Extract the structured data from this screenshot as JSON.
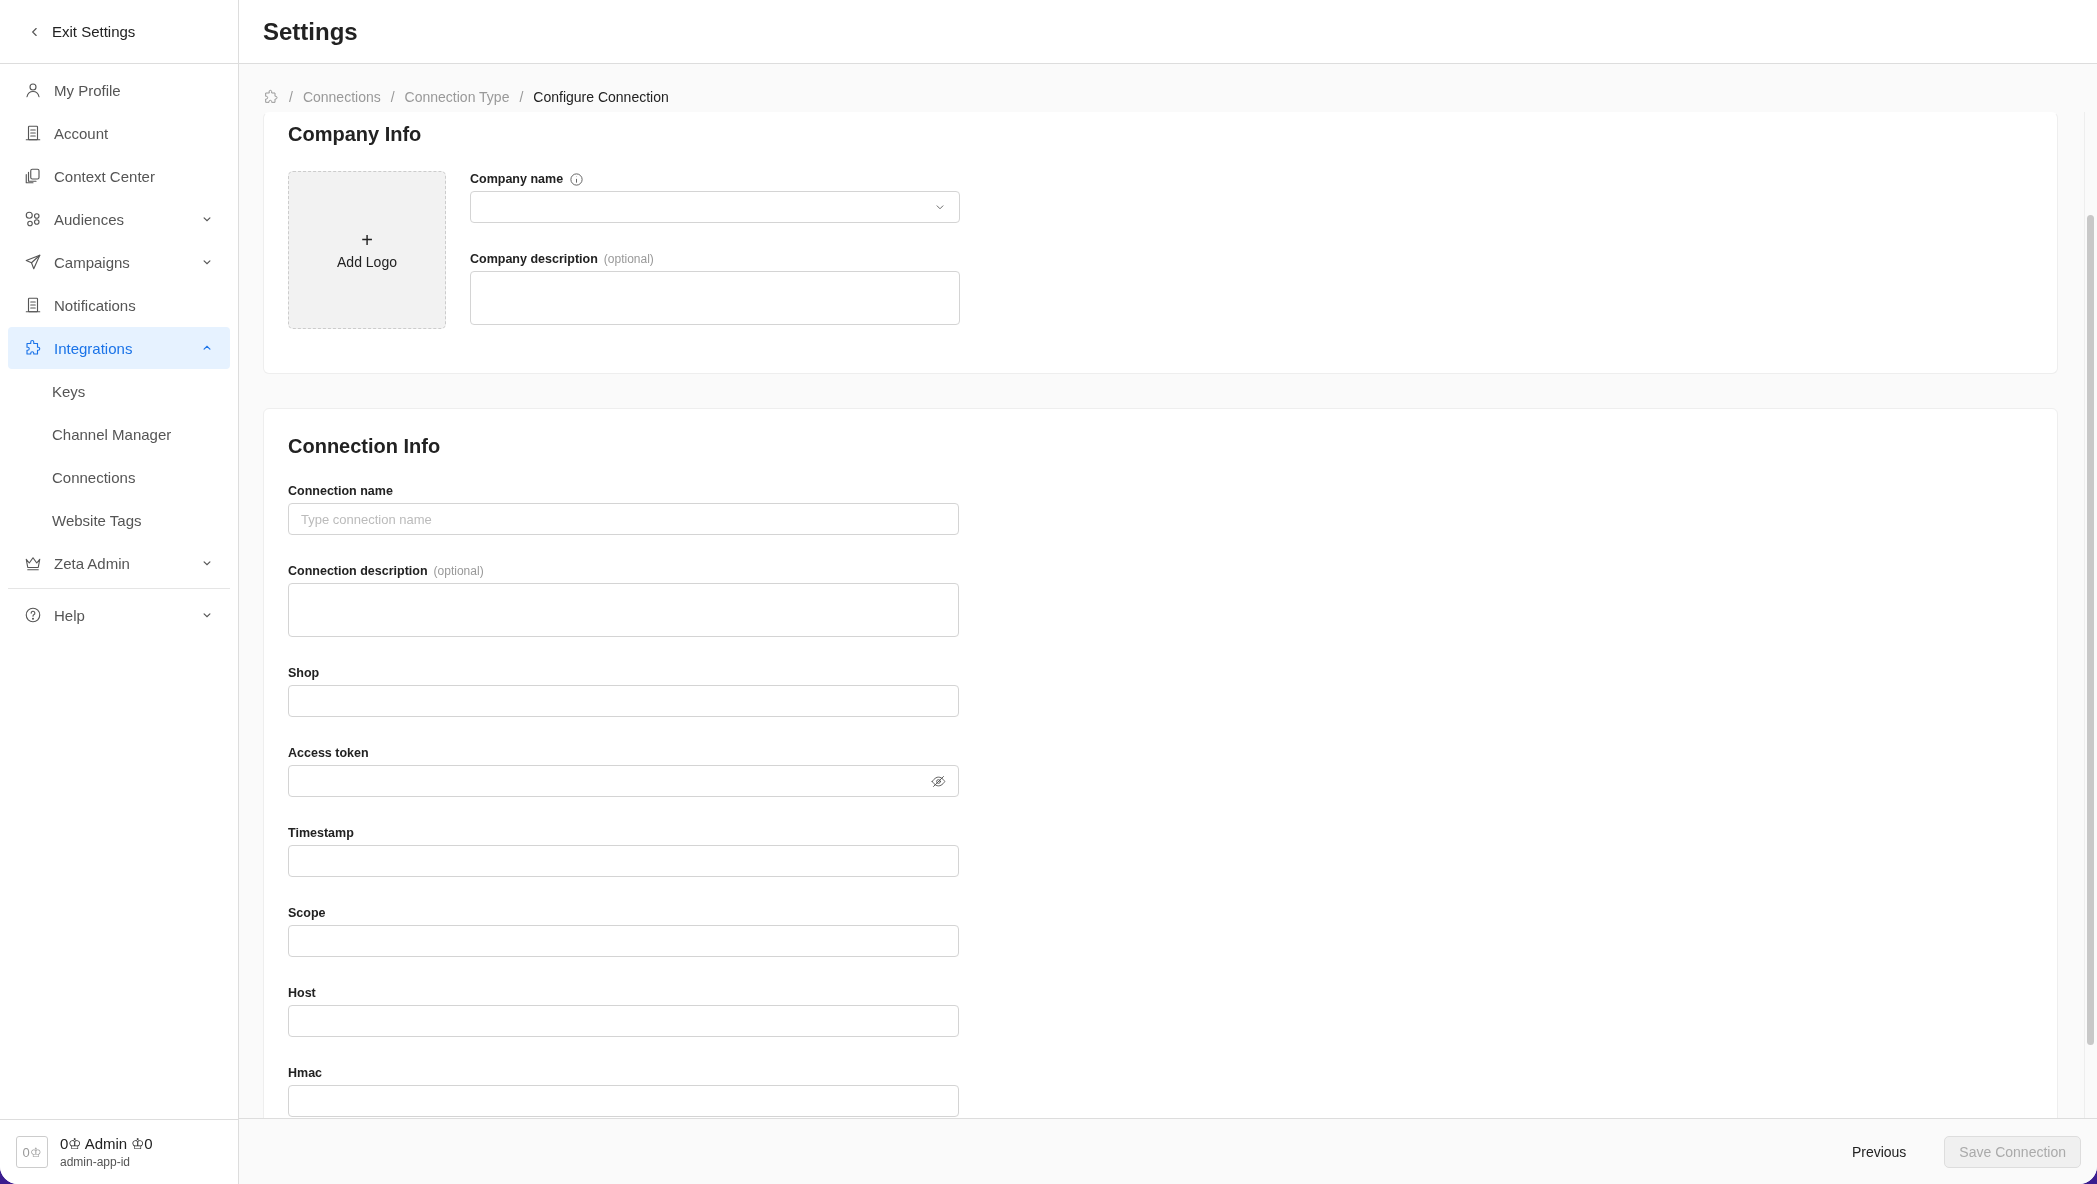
{
  "header": {
    "back_label": "Exit Settings",
    "title": "Settings"
  },
  "sidebar": {
    "groups": [
      {
        "items": [
          {
            "label": "My Profile",
            "selected": false
          },
          {
            "label": "Account",
            "selected": false
          },
          {
            "label": "Context Center",
            "selected": false
          },
          {
            "label": "Audiences",
            "selected": false,
            "expanded": false
          },
          {
            "label": "Campaigns",
            "selected": false,
            "expanded": false
          },
          {
            "label": "Notifications",
            "selected": false
          },
          {
            "label": "Integrations",
            "selected": true,
            "expanded": true,
            "children": [
              {
                "label": "Keys",
                "selected": false
              },
              {
                "label": "Channel Manager",
                "selected": false
              },
              {
                "label": "Connections",
                "selected": false
              },
              {
                "label": "Website Tags",
                "selected": false
              }
            ]
          },
          {
            "label": "Zeta Admin",
            "selected": false,
            "expanded": false
          }
        ]
      },
      {
        "items": [
          {
            "label": "Help",
            "selected": false,
            "expanded": false
          }
        ]
      }
    ]
  },
  "breadcrumb": [
    {
      "separator": "/",
      "label": "Connections",
      "current": false
    },
    {
      "separator": "/",
      "label": "Connection Type",
      "current": false
    },
    {
      "separator": "/",
      "label": "Configure Connection",
      "current": true
    }
  ],
  "company_card": {
    "title": "Company Info",
    "logo": {
      "plus": "+",
      "label": "Add Logo"
    },
    "fields": [
      {
        "kind": "select",
        "label": "Company name",
        "info": true
      },
      {
        "kind": "textarea",
        "label": "Company description",
        "optional": "(optional)"
      }
    ]
  },
  "connection_card": {
    "title": "Connection Info",
    "fields": [
      {
        "kind": "text",
        "label": "Connection name",
        "placeholder": "Type connection name"
      },
      {
        "kind": "textarea",
        "label": "Connection description",
        "optional": "(optional)"
      },
      {
        "kind": "text",
        "label": "Shop"
      },
      {
        "kind": "password",
        "label": "Access token"
      },
      {
        "kind": "text",
        "label": "Timestamp"
      },
      {
        "kind": "text",
        "label": "Scope"
      },
      {
        "kind": "text",
        "label": "Host"
      },
      {
        "kind": "text",
        "label": "Hmac"
      }
    ]
  },
  "user": {
    "avatar": "0♔",
    "name": "0♔ Admin ♔0",
    "app_id": "admin-app-id"
  },
  "footer": {
    "buttons": [
      {
        "kind": "text",
        "label": "Previous",
        "disabled": false
      },
      {
        "kind": "outline",
        "label": "Save Connection",
        "disabled": true
      }
    ]
  }
}
